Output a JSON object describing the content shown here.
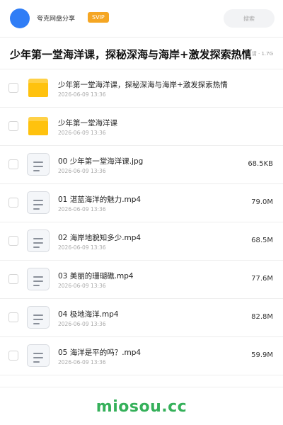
{
  "header": {
    "brand": "夸克网盘分享",
    "badge": "SVIP",
    "search_placeholder": "搜索"
  },
  "share": {
    "title": "少年第一堂海洋课，探秘深海与海岸+激发探索热情",
    "meta": "请 · 1.7G"
  },
  "colors": {
    "accent": "#2f7df6",
    "badge": "#f5a623",
    "folder": "#ffc20e",
    "watermark": "#35b05a"
  },
  "files": [
    {
      "type": "folder",
      "icon": "folder-icon",
      "name": "少年第一堂海洋课，探秘深海与海岸+激发探索热情",
      "date": "2026-06-09 13:36",
      "size": ""
    },
    {
      "type": "folder",
      "icon": "folder-icon",
      "name": "少年第一堂海洋课",
      "date": "2026-06-09 13:36",
      "size": ""
    },
    {
      "type": "file",
      "icon": "file-icon",
      "name": "00 少年第一堂海洋课.jpg",
      "date": "2026-06-09 13:36",
      "size": "68.5KB"
    },
    {
      "type": "file",
      "icon": "file-icon",
      "name": "01 湛蓝海洋的魅力.mp4",
      "date": "2026-06-09 13:36",
      "size": "79.0M"
    },
    {
      "type": "file",
      "icon": "file-icon",
      "name": "02 海岸地貌知多少.mp4",
      "date": "2026-06-09 13:36",
      "size": "68.5M"
    },
    {
      "type": "file",
      "icon": "file-icon",
      "name": "03 美丽的珊瑚礁.mp4",
      "date": "2026-06-09 13:36",
      "size": "77.6M"
    },
    {
      "type": "file",
      "icon": "file-icon",
      "name": "04 极地海洋.mp4",
      "date": "2026-06-09 13:36",
      "size": "82.8M"
    },
    {
      "type": "file",
      "icon": "file-icon",
      "name": "05 海洋是平的吗？.mp4",
      "date": "2026-06-09 13:36",
      "size": "59.9M"
    }
  ],
  "footer": {
    "watermark": "miosou.cc"
  }
}
